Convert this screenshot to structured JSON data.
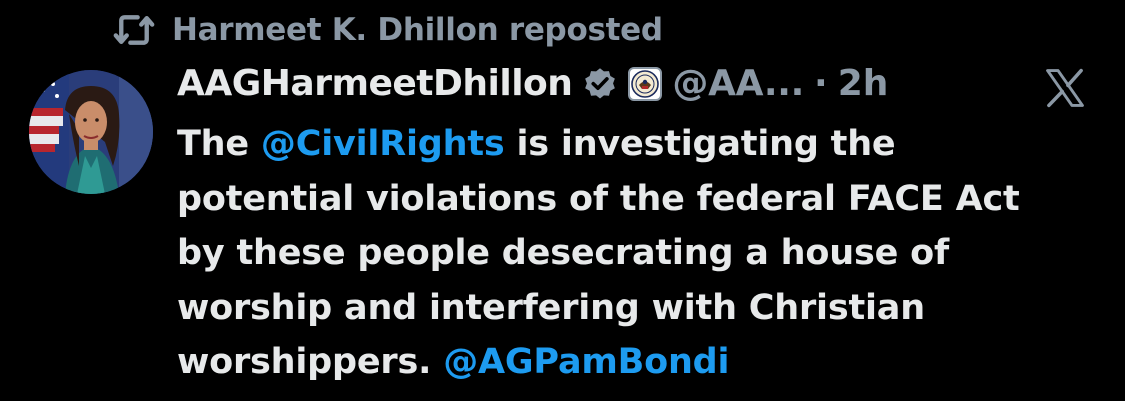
{
  "repost": {
    "icon": "repost-icon",
    "text": "Harmeet K. Dhillon reposted"
  },
  "author": {
    "avatar": "avatar",
    "display_name": "AAGHarmeetDhillon",
    "verified_icon": "verified-badge-icon",
    "affiliate_icon": "doj-seal-icon",
    "handle": "@AA...",
    "separator": "·",
    "timestamp": "2h"
  },
  "brand": {
    "logo": "x-logo-icon"
  },
  "post": {
    "line1": {
      "before": "The ",
      "mention": "@CivilRights",
      "after": " is investigating the"
    },
    "line2": "potential violations of the federal FACE Act",
    "line3": "by these people desecrating a house of",
    "line4": "worship and interfering with Christian",
    "line5": {
      "before": "worshippers. ",
      "mention": "@AGPamBondi"
    }
  },
  "colors": {
    "background": "#000000",
    "text": "#e7e9ea",
    "muted": "#8b98a5",
    "link": "#1d9bf0",
    "verified": "#8b98a5"
  }
}
